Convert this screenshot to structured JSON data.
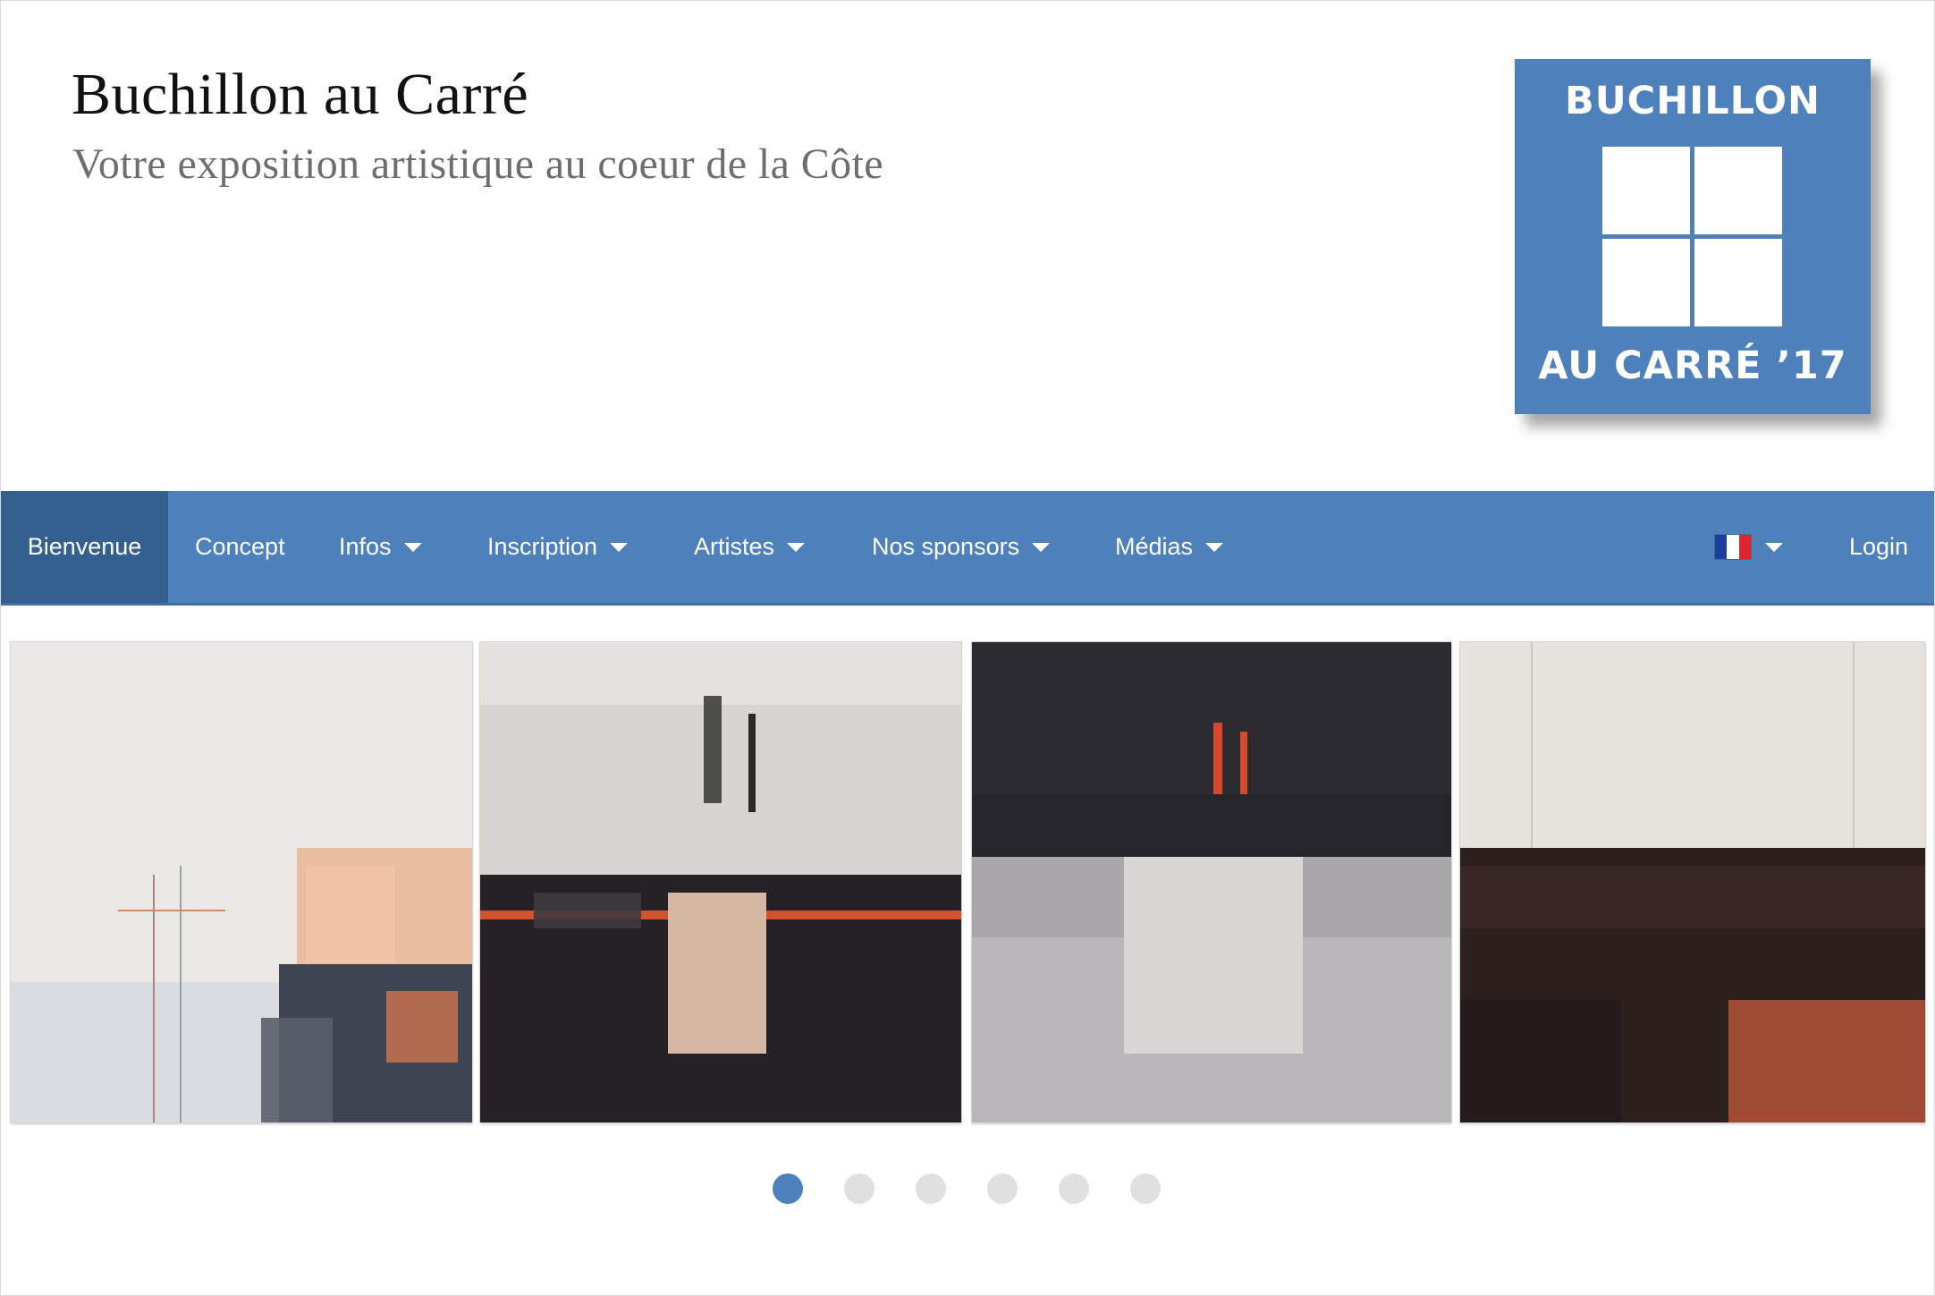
{
  "header": {
    "title": "Buchillon au Carré",
    "subtitle": "Votre exposition artistique au coeur de la Côte"
  },
  "logo": {
    "line1": "BUCHILLON",
    "line2": "AU CARRÉ ’17"
  },
  "nav": {
    "items": [
      {
        "label": "Bienvenue",
        "active": true,
        "dropdown": false
      },
      {
        "label": "Concept",
        "dropdown": false
      },
      {
        "label": "Infos",
        "dropdown": true
      },
      {
        "label": "Inscription",
        "dropdown": true
      },
      {
        "label": "Artistes",
        "dropdown": true
      },
      {
        "label": "Nos sponsors",
        "dropdown": true
      },
      {
        "label": "Médias",
        "dropdown": true
      }
    ],
    "language": "fr",
    "login": "Login"
  },
  "carousel": {
    "slides_visible": 4,
    "dots": 6,
    "active_dot": 1
  },
  "colors": {
    "brand_blue": "#4e80bb",
    "nav_active": "#34608f",
    "dot_inactive": "#e0e0e0"
  }
}
